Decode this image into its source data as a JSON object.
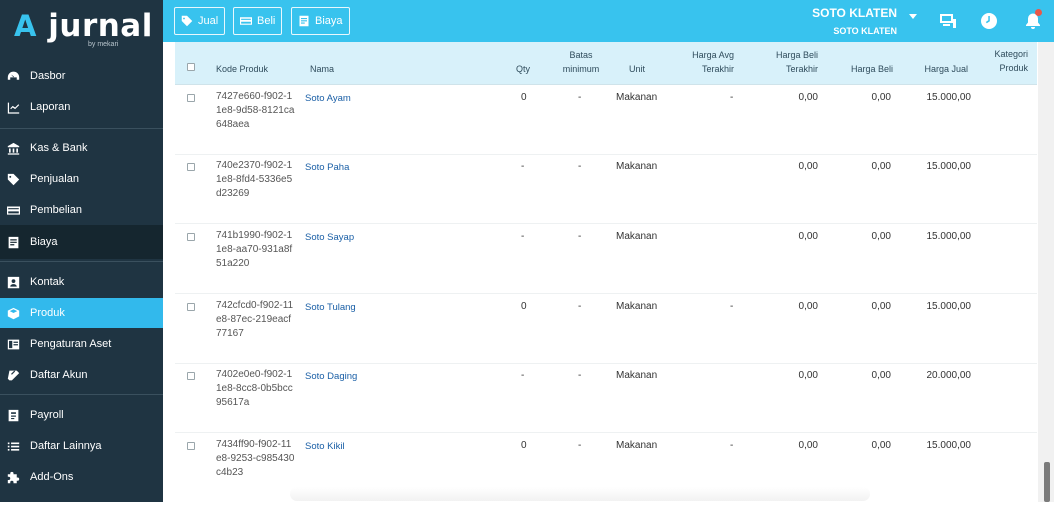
{
  "logo": {
    "text": "jurnal",
    "sub": "by mekari"
  },
  "sidebar": {
    "items": [
      {
        "label": "Dasbor",
        "icon": "dashboard-icon"
      },
      {
        "label": "Laporan",
        "icon": "chart-icon"
      },
      {
        "label": "Kas & Bank",
        "icon": "bank-icon"
      },
      {
        "label": "Penjualan",
        "icon": "tag-icon"
      },
      {
        "label": "Pembelian",
        "icon": "card-icon"
      },
      {
        "label": "Biaya",
        "icon": "receipt-icon"
      },
      {
        "label": "Kontak",
        "icon": "contact-icon"
      },
      {
        "label": "Produk",
        "icon": "box-icon"
      },
      {
        "label": "Pengaturan Aset",
        "icon": "asset-icon"
      },
      {
        "label": "Daftar Akun",
        "icon": "book-icon"
      },
      {
        "label": "Payroll",
        "icon": "payroll-icon"
      },
      {
        "label": "Daftar Lainnya",
        "icon": "list-icon"
      },
      {
        "label": "Add-Ons",
        "icon": "puzzle-icon"
      }
    ]
  },
  "toolbar": {
    "jual": "Jual",
    "beli": "Beli",
    "biaya": "Biaya"
  },
  "company": {
    "name": "SOTO KLATEN",
    "sub": "SOTO KLATEN"
  },
  "table": {
    "headers": {
      "kode": "Kode Produk",
      "nama": "Nama",
      "qty": "Qty",
      "batas1": "Batas",
      "batas2": "minimum",
      "unit": "Unit",
      "avg1": "Harga Avg",
      "avg2": "Terakhir",
      "beli_t1": "Harga Beli",
      "beli_t2": "Terakhir",
      "harga_beli": "Harga Beli",
      "harga_jual": "Harga Jual",
      "kat1": "Kategori",
      "kat2": "Produk"
    },
    "rows": [
      {
        "code": "7427e660-f902-11e8-9d58-8121ca648aea",
        "name": "Soto Ayam",
        "qty": "0",
        "batas": "-",
        "unit": "Makanan",
        "avg": "-",
        "beli_terakhir": "0,00",
        "harga_beli": "0,00",
        "harga_jual": "15.000,00"
      },
      {
        "code": "740e2370-f902-11e8-8fd4-5336e5d23269",
        "name": "Soto Paha",
        "qty": "-",
        "batas": "-",
        "unit": "Makanan",
        "avg": "",
        "beli_terakhir": "0,00",
        "harga_beli": "0,00",
        "harga_jual": "15.000,00"
      },
      {
        "code": "741b1990-f902-11e8-aa70-931a8f51a220",
        "name": "Soto Sayap",
        "qty": "-",
        "batas": "-",
        "unit": "Makanan",
        "avg": "",
        "beli_terakhir": "0,00",
        "harga_beli": "0,00",
        "harga_jual": "15.000,00"
      },
      {
        "code": "742cfcd0-f902-11e8-87ec-219eacf77167",
        "name": "Soto Tulang",
        "qty": "0",
        "batas": "-",
        "unit": "Makanan",
        "avg": "-",
        "beli_terakhir": "0,00",
        "harga_beli": "0,00",
        "harga_jual": "15.000,00"
      },
      {
        "code": "7402e0e0-f902-11e8-8cc8-0b5bcc95617a",
        "name": "Soto Daging",
        "qty": "-",
        "batas": "-",
        "unit": "Makanan",
        "avg": "",
        "beli_terakhir": "0,00",
        "harga_beli": "0,00",
        "harga_jual": "20.000,00"
      },
      {
        "code": "7434ff90-f902-11e8-9253-c985430c4b23",
        "name": "Soto Kikil",
        "qty": "0",
        "batas": "-",
        "unit": "Makanan",
        "avg": "-",
        "beli_terakhir": "0,00",
        "harga_beli": "0,00",
        "harga_jual": "15.000,00"
      }
    ]
  },
  "colors": {
    "sidebar": "#1f3442",
    "accent": "#38c3ee",
    "active": "#32b9ec"
  }
}
